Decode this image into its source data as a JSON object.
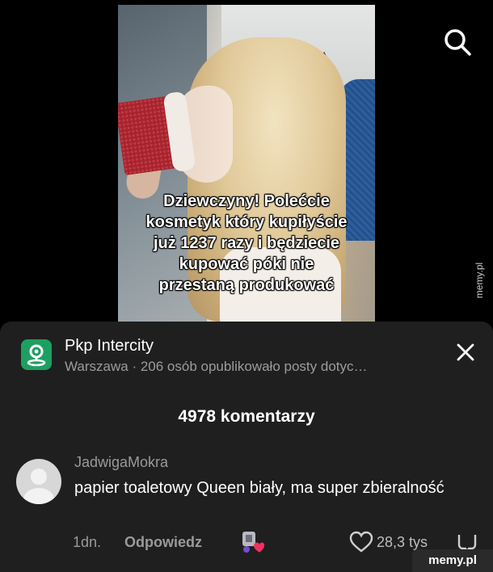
{
  "video": {
    "caption": "Dziewczyny! Polećcie\nkosmetyk który kupiłyście\njuż 1237 razy i będziecie\nkupować póki nie\nprzestaną produkować"
  },
  "header": {
    "search_icon": "search-icon"
  },
  "watermark": {
    "vertical": "memy.pl",
    "footer": "memy.pl"
  },
  "place": {
    "icon": "map-pin-icon",
    "name": "Pkp Intercity",
    "subtitle": "Warszawa · 206 osób opublikowało posty dotyc…",
    "close_icon": "close-icon",
    "accent": "#1e9f62"
  },
  "comments": {
    "count_label": "4978 komentarzy",
    "items": [
      {
        "username": "JadwigaMokra",
        "text": "papier toaletowy Queen biały, ma super zbieralność",
        "time": "1dn.",
        "reply_label": "Odpowiedz",
        "likes": "28,3 tys"
      }
    ]
  },
  "colors": {
    "background": "#000000",
    "sheet": "#1f1f1f",
    "muted_text": "#9a9a9a"
  }
}
